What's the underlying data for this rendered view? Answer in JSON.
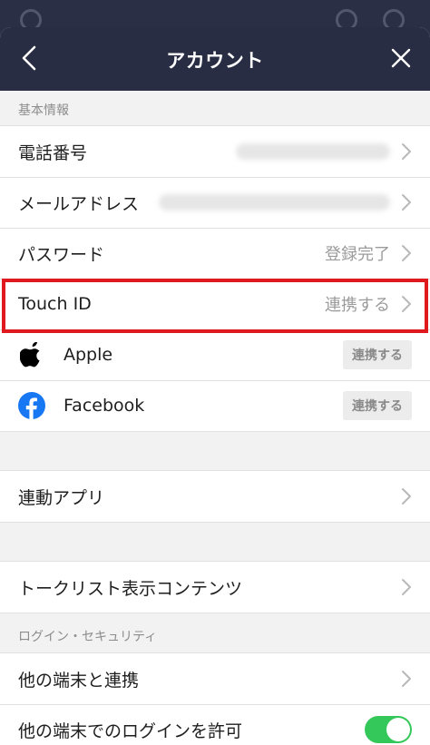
{
  "header": {
    "title": "アカウント"
  },
  "sections": {
    "basic_info_label": "基本情報",
    "security_label": "ログイン・セキュリティ"
  },
  "rows": {
    "phone": {
      "label": "電話番号"
    },
    "email": {
      "label": "メールアドレス"
    },
    "password": {
      "label": "パスワード",
      "value": "登録完了"
    },
    "touch_id": {
      "label": "Touch ID",
      "value": "連携する"
    },
    "apple": {
      "label": "Apple",
      "button": "連携する"
    },
    "facebook": {
      "label": "Facebook",
      "button": "連携する"
    },
    "linked_apps": {
      "label": "連動アプリ"
    },
    "talk_list": {
      "label": "トークリスト表示コンテンツ"
    },
    "other_devices": {
      "label": "他の端末と連携"
    },
    "login_permission": {
      "label": "他の端末でのログインを許可",
      "toggle": "on"
    }
  },
  "colors": {
    "header_bg": "#282d44",
    "highlight": "#e0191e",
    "facebook": "#1877f2",
    "toggle_on": "#34c759"
  },
  "icons": {
    "back": "chevron-left-icon",
    "close": "close-icon",
    "apple": "apple-logo-icon",
    "facebook": "facebook-logo-icon",
    "row_chevron": "chevron-right-icon"
  }
}
